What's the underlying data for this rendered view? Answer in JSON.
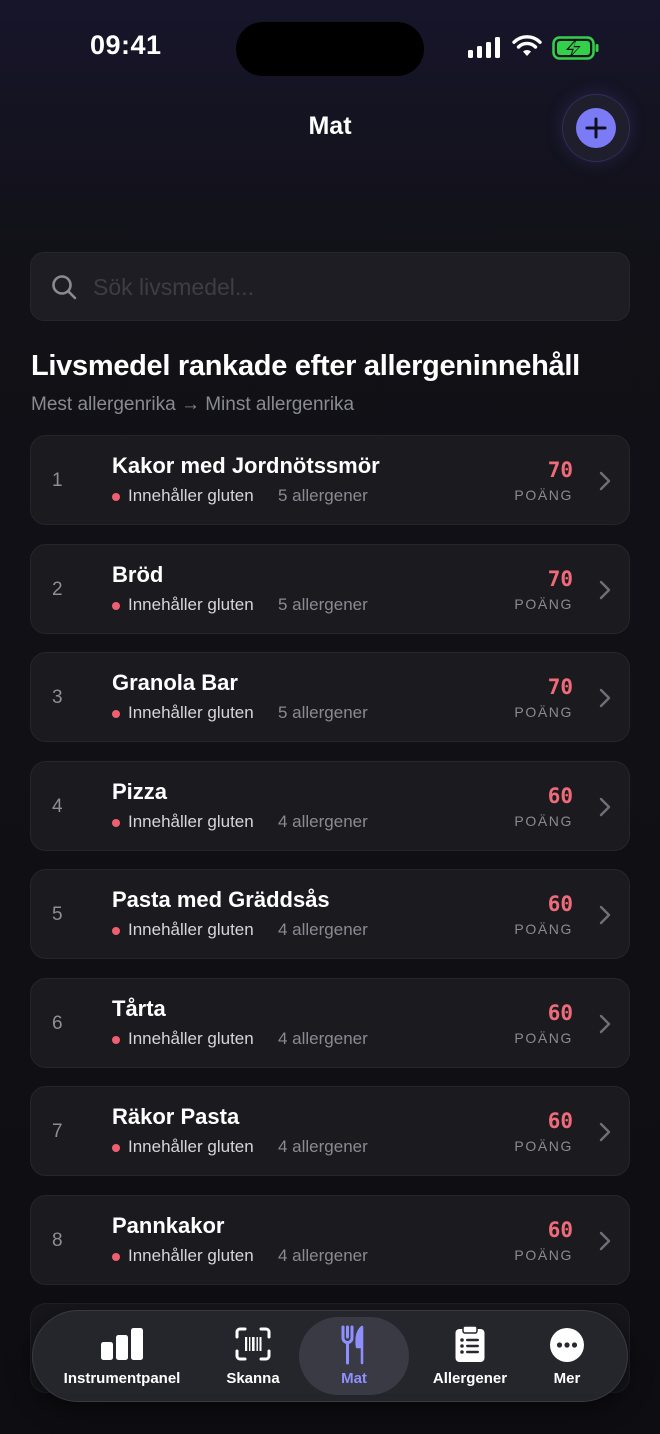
{
  "status": {
    "time": "09:41"
  },
  "header": {
    "title": "Mat"
  },
  "search": {
    "placeholder": "Sök livsmedel..."
  },
  "section": {
    "title": "Livsmedel rankade efter allergeninnehåll",
    "subtitle": "Mest allergenrika → Minst allergenrika"
  },
  "foods": [
    {
      "rank": "1",
      "name": "Kakor med Jordnötssmör",
      "tag": "Innehåller gluten",
      "count": "5 allergener",
      "score": "70",
      "score_label": "POÄNG"
    },
    {
      "rank": "2",
      "name": "Bröd",
      "tag": "Innehåller gluten",
      "count": "5 allergener",
      "score": "70",
      "score_label": "POÄNG"
    },
    {
      "rank": "3",
      "name": "Granola Bar",
      "tag": "Innehåller gluten",
      "count": "5 allergener",
      "score": "70",
      "score_label": "POÄNG"
    },
    {
      "rank": "4",
      "name": "Pizza",
      "tag": "Innehåller gluten",
      "count": "4 allergener",
      "score": "60",
      "score_label": "POÄNG"
    },
    {
      "rank": "5",
      "name": "Pasta med Gräddsås",
      "tag": "Innehåller gluten",
      "count": "4 allergener",
      "score": "60",
      "score_label": "POÄNG"
    },
    {
      "rank": "6",
      "name": "Tårta",
      "tag": "Innehåller gluten",
      "count": "4 allergener",
      "score": "60",
      "score_label": "POÄNG"
    },
    {
      "rank": "7",
      "name": "Räkor Pasta",
      "tag": "Innehåller gluten",
      "count": "4 allergener",
      "score": "60",
      "score_label": "POÄNG"
    },
    {
      "rank": "8",
      "name": "Pannkakor",
      "tag": "Innehåller gluten",
      "count": "4 allergener",
      "score": "60",
      "score_label": "POÄNG"
    }
  ],
  "tabbar": {
    "tabs": [
      {
        "label": "Instrumentpanel",
        "icon": "bar-chart-icon"
      },
      {
        "label": "Skanna",
        "icon": "barcode-scan-icon"
      },
      {
        "label": "Mat",
        "icon": "fork-knife-icon",
        "active": true
      },
      {
        "label": "Allergener",
        "icon": "clipboard-list-icon"
      },
      {
        "label": "Mer",
        "icon": "more-ellipsis-icon"
      }
    ]
  },
  "colors": {
    "accent": "#7b7cf5",
    "active_tab": "#8e90ff",
    "score": "#ef6b7a",
    "warning_dot": "#ef5f6f",
    "card_bg": "#1a1a1f",
    "background": "#0e0e12"
  }
}
